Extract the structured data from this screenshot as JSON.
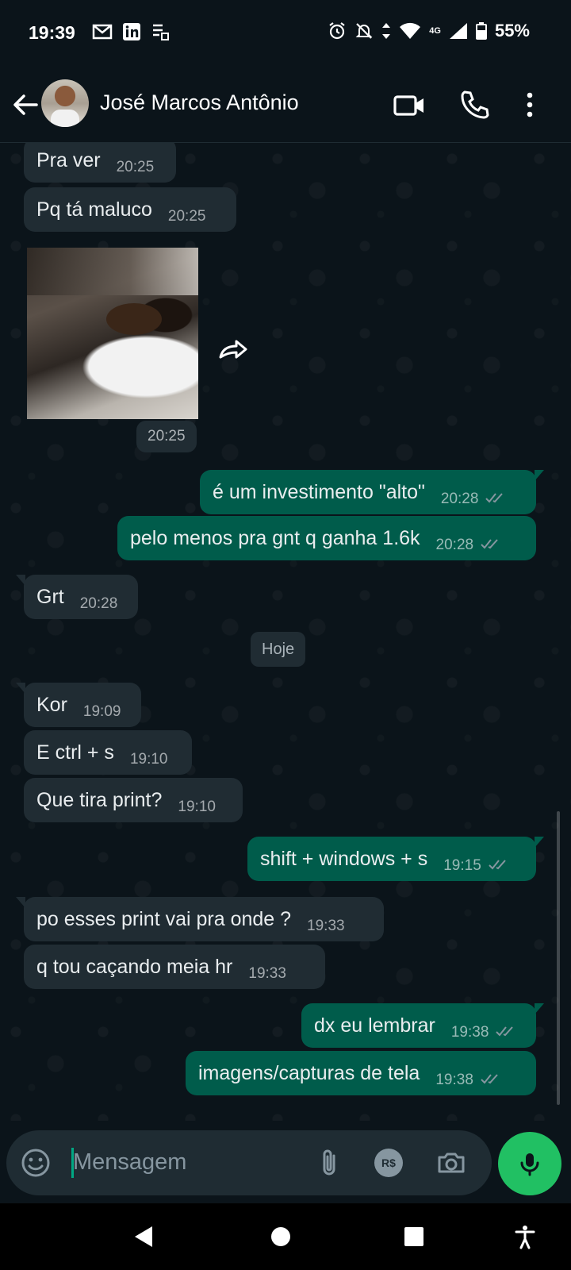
{
  "status_bar": {
    "time": "19:39",
    "network": "4G",
    "battery_percent": "55%"
  },
  "header": {
    "contact_name": "José Marcos Antônio",
    "icons": [
      "back-arrow-icon",
      "video-call-icon",
      "phone-icon",
      "more-vert-icon"
    ]
  },
  "messages": [
    {
      "dir": "in",
      "text": "Pra ver",
      "time": "20:25"
    },
    {
      "dir": "in",
      "text": "Pq tá maluco",
      "time": "20:25"
    },
    {
      "dir": "in",
      "type": "image",
      "time": "20:25"
    },
    {
      "dir": "out",
      "text": "é um investimento \"alto\"",
      "time": "20:28",
      "status": "read"
    },
    {
      "dir": "out",
      "text": "pelo menos pra gnt q ganha 1.6k",
      "time": "20:28",
      "status": "read"
    },
    {
      "dir": "in",
      "text": "Grt",
      "time": "20:28"
    },
    {
      "dir": "in",
      "text": "Kor",
      "time": "19:09"
    },
    {
      "dir": "in",
      "text": "E ctrl + s",
      "time": "19:10"
    },
    {
      "dir": "in",
      "text": "Que tira print?",
      "time": "19:10"
    },
    {
      "dir": "out",
      "text": "shift + windows + s",
      "time": "19:15",
      "status": "read"
    },
    {
      "dir": "in",
      "text": "po esses print vai pra onde ?",
      "time": "19:33"
    },
    {
      "dir": "in",
      "text": "q tou caçando meia hr",
      "time": "19:33"
    },
    {
      "dir": "out",
      "text": "dx eu lembrar",
      "time": "19:38",
      "status": "read"
    },
    {
      "dir": "out",
      "text": "imagens/capturas de tela",
      "time": "19:38",
      "status": "read"
    }
  ],
  "day_divider": "Hoje",
  "composer": {
    "placeholder": "Mensagem",
    "icons": [
      "emoji-icon",
      "attach-icon",
      "payment-icon",
      "camera-icon",
      "mic-icon"
    ],
    "payment_label": "R$"
  },
  "colors": {
    "background": "#0b141a",
    "incoming_bubble": "#202c33",
    "outgoing_bubble": "#005c4b",
    "read_ticks": "#8696a0",
    "mic_button": "#21c063"
  }
}
